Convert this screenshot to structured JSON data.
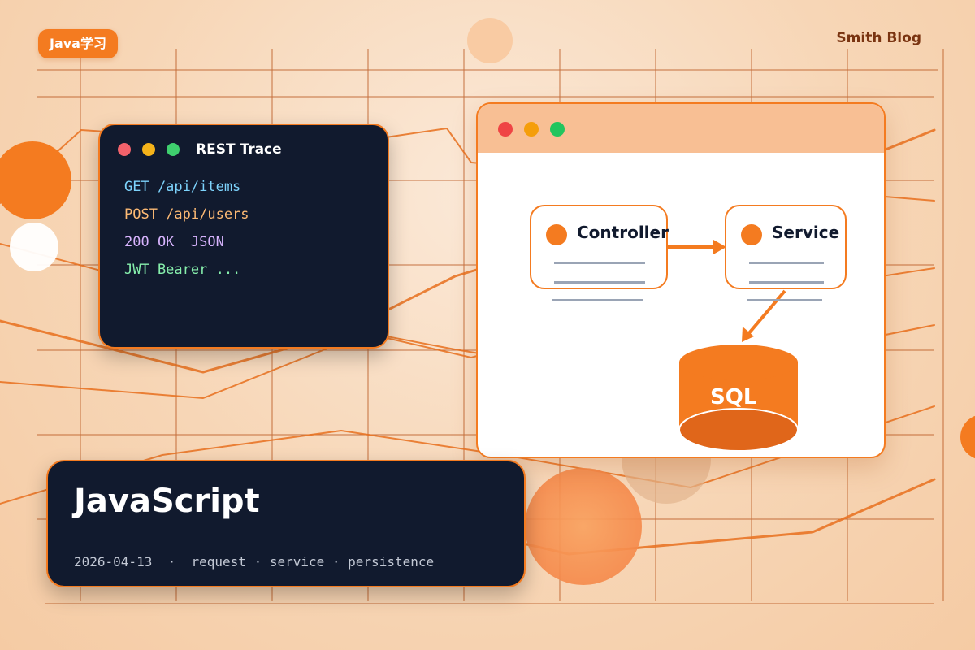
{
  "badge": {
    "label": "Java学习"
  },
  "brand": {
    "name": "Smith Blog"
  },
  "terminal": {
    "title": "REST Trace",
    "lines": [
      {
        "text": "GET /api/items",
        "color": "#7dd3fc"
      },
      {
        "text": "POST /api/users",
        "color": "#fdba74"
      },
      {
        "text": "200 OK  JSON",
        "color": "#d8b4fe"
      },
      {
        "text": "JWT Bearer ...",
        "color": "#86efac"
      }
    ]
  },
  "diagram": {
    "controller_label": "Controller",
    "service_label": "Service",
    "database_label": "SQL"
  },
  "card": {
    "title": "JavaScript",
    "date": "2026-04-13",
    "separator": "·",
    "tags": "request · service · persistence"
  },
  "colors": {
    "accent": "#f47b20",
    "dark_panel": "#111a2e",
    "browser_bar": "#f8bf94"
  }
}
